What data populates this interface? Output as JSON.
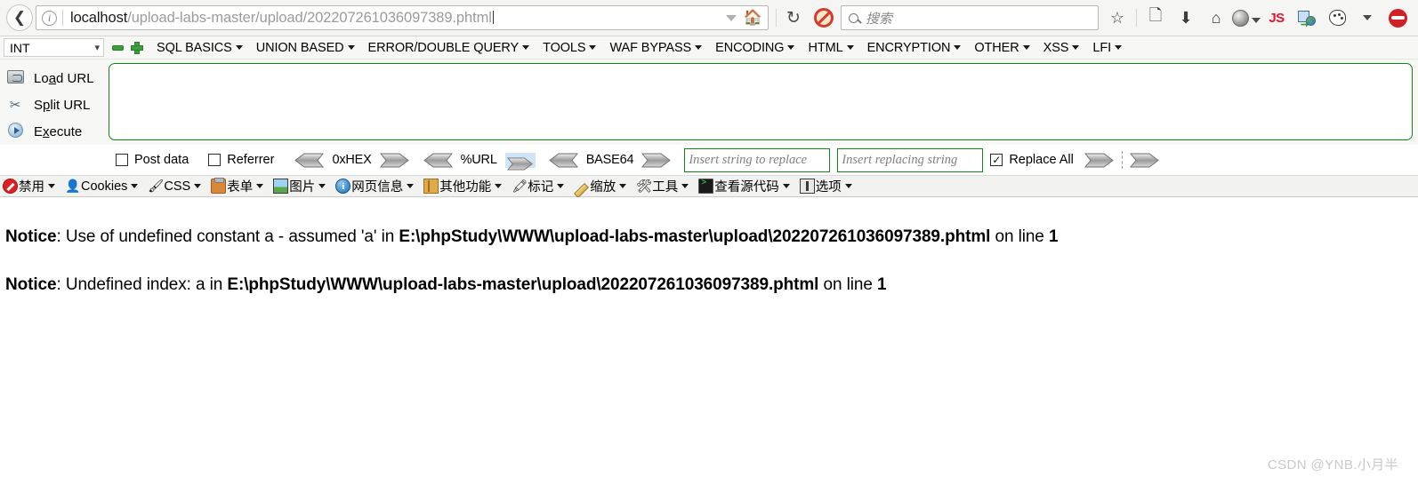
{
  "browser": {
    "back_icon": "back-arrow-icon",
    "identity_icon": "info-icon",
    "url_host": "localhost",
    "url_path": "/upload-labs-master/upload/202207261036097389.phtml",
    "url_full": "localhost/upload-labs-master/upload/202207261036097389.phtml",
    "dropdown_icon": "chevron-down-icon",
    "home_icon": "home-icon",
    "reload_icon": "reload-icon",
    "noscript_icon": "noscript-blocked-icon",
    "search_placeholder": "搜索",
    "search_icon": "search-icon",
    "right_icons": [
      {
        "name": "bookmark-star-icon",
        "glyph": "☆"
      },
      {
        "name": "reader-list-icon",
        "glyph": "▤"
      },
      {
        "name": "downloads-icon",
        "glyph": "⬇"
      },
      {
        "name": "home-icon",
        "glyph": "⌂"
      },
      {
        "name": "globe-avatar-icon",
        "glyph": ""
      },
      {
        "name": "javascript-toggle-icon",
        "glyph": "JS"
      },
      {
        "name": "proxy-switch-icon",
        "glyph": ""
      },
      {
        "name": "palette-theme-icon",
        "glyph": ""
      },
      {
        "name": "overflow-menu-icon",
        "glyph": ""
      },
      {
        "name": "hackbar-icon",
        "glyph": ""
      }
    ]
  },
  "hackbar": {
    "type_select_value": "INT",
    "type_select_caret": "chevron-down-icon",
    "remove_button": "minus-icon",
    "add_button": "plus-icon",
    "menus": [
      {
        "label": "SQL BASICS"
      },
      {
        "label": "UNION BASED"
      },
      {
        "label": "ERROR/DOUBLE QUERY"
      },
      {
        "label": "TOOLS"
      },
      {
        "label": "WAF BYPASS"
      },
      {
        "label": "ENCODING"
      },
      {
        "label": "HTML"
      },
      {
        "label": "ENCRYPTION"
      },
      {
        "label": "OTHER"
      },
      {
        "label": "XSS"
      },
      {
        "label": "LFI"
      }
    ],
    "actions": [
      {
        "label_pre": "Lo",
        "label_key": "a",
        "label_post": "d URL",
        "icon": "load-url-icon"
      },
      {
        "label_pre": "S",
        "label_key": "p",
        "label_post": "lit URL",
        "icon": "split-url-icon"
      },
      {
        "label_pre": "E",
        "label_key": "x",
        "label_post": "ecute",
        "icon": "execute-icon"
      }
    ],
    "url_textarea_value": "",
    "options": {
      "post_data_label": "Post data",
      "post_data_checked": false,
      "referrer_label": "Referrer",
      "referrer_checked": false,
      "hex_label": "0xHEX",
      "url_label": "%URL",
      "base64_label": "BASE64",
      "replace_search_placeholder": "Insert string to replace",
      "replace_search_value": "",
      "replace_with_placeholder": "Insert replacing string",
      "replace_with_value": "",
      "replace_all_label": "Replace All",
      "replace_all_checked": true,
      "checkmark": "✓"
    }
  },
  "webdev_toolbar": {
    "items": [
      {
        "label": "禁用",
        "icon": "disable-icon"
      },
      {
        "label": "Cookies",
        "icon": "cookies-icon"
      },
      {
        "label": "CSS",
        "icon": "css-icon"
      },
      {
        "label": "表单",
        "icon": "forms-icon"
      },
      {
        "label": "图片",
        "icon": "images-icon"
      },
      {
        "label": "网页信息",
        "icon": "page-info-icon"
      },
      {
        "label": "其他功能",
        "icon": "misc-icon"
      },
      {
        "label": "标记",
        "icon": "outline-icon"
      },
      {
        "label": "缩放",
        "icon": "resize-icon"
      },
      {
        "label": "工具",
        "icon": "tools-icon"
      },
      {
        "label": "查看源代码",
        "icon": "view-source-icon"
      },
      {
        "label": "选项",
        "icon": "options-icon"
      }
    ]
  },
  "page_content": {
    "notices": [
      {
        "label": "Notice",
        "colon": ": ",
        "message": "Use of undefined constant a - assumed 'a' in ",
        "path": "E:\\phpStudy\\WWW\\upload-labs-master\\upload\\202207261036097389.phtml",
        "on_line_text": " on line ",
        "line_number": "1"
      },
      {
        "label": "Notice",
        "colon": ": ",
        "message": "Undefined index: a in ",
        "path": "E:\\phpStudy\\WWW\\upload-labs-master\\upload\\202207261036097389.phtml",
        "on_line_text": " on line ",
        "line_number": "1"
      }
    ],
    "watermark": "CSDN @YNB.小月半"
  },
  "colors": {
    "hackbar_green": "#118611",
    "notice_text": "#000000",
    "chrome_bg": "#f5f5f4",
    "highlight_blue": "#cfe5f7",
    "watermark_gray": "#c9c9c9"
  }
}
